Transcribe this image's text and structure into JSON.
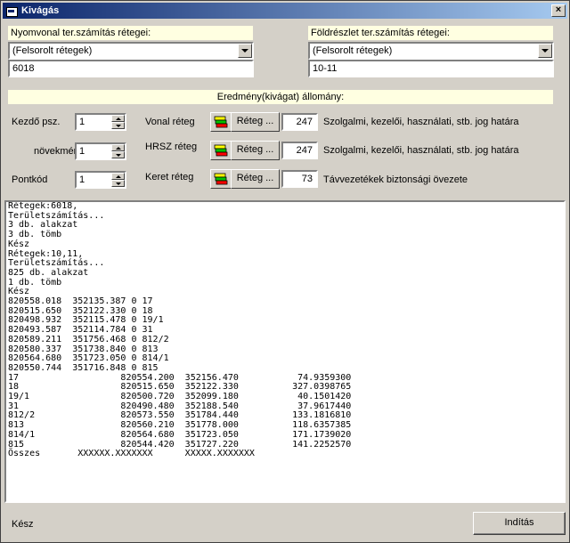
{
  "window": {
    "title": "Kivágás",
    "close_label": "×"
  },
  "left_panel": {
    "label": "Nyomvonal  ter.számítás rétegei:",
    "combo_value": "(Felsorolt rétegek)",
    "text_value": "6018"
  },
  "right_panel": {
    "label": "Földrészlet ter.számítás rétegei:",
    "combo_value": "(Felsorolt rétegek)",
    "text_value": "10-11"
  },
  "result_header": "Eredmény(kivágat) állomány:",
  "params": {
    "start_label": "Kezdő psz.",
    "start_value": "1",
    "increment_label": "növekmény",
    "increment_value": "1",
    "pointcode_label": "Pontkód",
    "pointcode_value": "1"
  },
  "layers": [
    {
      "label": "Vonal réteg",
      "button": "Réteg ...",
      "number": "247",
      "desc": "Szolgalmi, kezelői, használati, stb. jog határa"
    },
    {
      "label": "HRSZ réteg",
      "button": "Réteg ...",
      "number": "247",
      "desc": "Szolgalmi, kezelői, használati, stb. jog határa"
    },
    {
      "label": "Keret réteg",
      "button": "Réteg ...",
      "number": "73",
      "desc": "Távvezetékek biztonsági övezete"
    }
  ],
  "log": [
    "Rétegek:6018,",
    "Területszámítás...",
    "3 db. alakzat",
    "3 db. tömb",
    "Kész",
    "Rétegek:10,11,",
    "Területszámítás...",
    "825 db. alakzat",
    "1 db. tömb",
    "Kész",
    "820558.018  352135.387 0 17",
    "820515.650  352122.330 0 18",
    "820498.932  352115.478 0 19/1",
    "820493.587  352114.784 0 31",
    "820589.211  351756.468 0 812/2",
    "820580.337  351738.840 0 813",
    "820564.680  351723.050 0 814/1",
    "820550.744  351716.848 0 815",
    "17                   820554.200  352156.470           74.9359300",
    "18                   820515.650  352122.330          327.0398765",
    "19/1                 820500.720  352099.180           40.1501420",
    "31                   820490.480  352188.540           37.9617440",
    "812/2                820573.550  351784.440          133.1816810",
    "813                  820560.210  351778.000          118.6357385",
    "814/1                820564.680  351723.050          171.1739020",
    "815                  820544.420  351727.220          141.2252570",
    "Összes       XXXXXX.XXXXXXX      XXXXX.XXXXXXX"
  ],
  "status": "Kész",
  "start_button": "Indítás",
  "icons": {
    "app": "window-icon",
    "layer": "layers-icon"
  }
}
